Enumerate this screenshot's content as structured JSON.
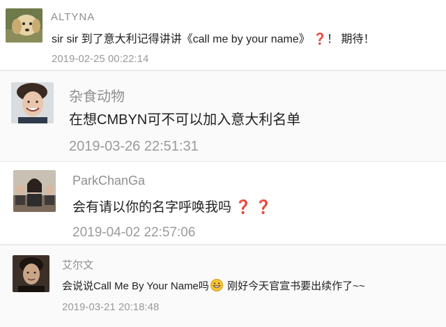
{
  "comments": [
    {
      "username": "ALTYNA",
      "text_before": "sir sir 到了意大利记得讲讲《call me by your name》",
      "marks": "❓",
      "text_after": "！ 期待！",
      "timestamp": "2019-02-25 00:22:14",
      "avatar_icon": "dog-avatar"
    },
    {
      "username": "杂食动物",
      "text_before": "在想CMBYN可不可以加入意大利名单",
      "timestamp": "2019-03-26 22:51:31",
      "avatar_icon": "smiling-man-avatar"
    },
    {
      "username": "ParkChanGa",
      "text_before": "会有请以你的名字呼唤我吗",
      "marks": "❓ ❓",
      "timestamp": "2019-04-02 22:57:06",
      "avatar_icon": "classroom-avatar"
    },
    {
      "username": "艾尔文",
      "text_before": "会说说Call Me By Your Name吗",
      "emoji": "grinning-face",
      "text_after": " 刚好今天官宣书要出续作了~~",
      "timestamp": "2019-03-21 20:18:48",
      "avatar_icon": "dark-portrait-avatar"
    }
  ],
  "colors": {
    "username": "#8f8f8f",
    "text": "#222222",
    "timestamp": "#9a9a9a",
    "question_mark": "#d21d24"
  }
}
